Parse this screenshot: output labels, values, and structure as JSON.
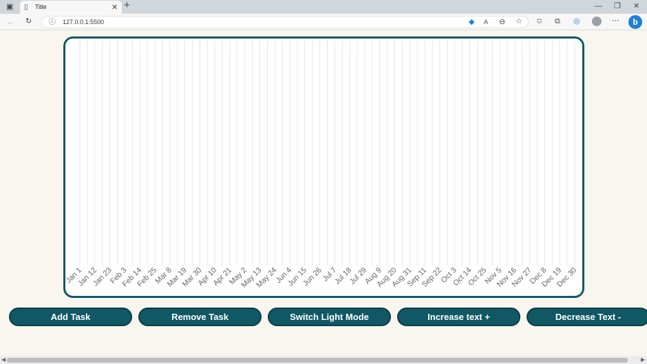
{
  "browser": {
    "tab_title": "Title",
    "url": "127.0.0.1:5500",
    "new_tab_symbol": "+"
  },
  "chart_data": {
    "type": "bar",
    "categories": [
      "Jan 1",
      "Jan 12",
      "Jan 23",
      "Feb 3",
      "Feb 14",
      "Feb 25",
      "Mar 8",
      "Mar 19",
      "Mar 30",
      "Apr 10",
      "Apr 21",
      "May 2",
      "May 13",
      "May 24",
      "Jun 4",
      "Jun 15",
      "Jun 26",
      "Jul 7",
      "Jul 18",
      "Jul 29",
      "Aug 9",
      "Aug 20",
      "Aug 31",
      "Sep 11",
      "Sep 22",
      "Oct 3",
      "Oct 14",
      "Oct 25",
      "Nov 5",
      "Nov 16",
      "Nov 27",
      "Dec 8",
      "Dec 19",
      "Dec 30"
    ],
    "values": [],
    "grid": true,
    "grid_color": "#e6e6e6",
    "border_color": "#115865"
  },
  "buttons": {
    "add": "Add Task",
    "remove": "Remove Task",
    "switch_mode": "Switch Light Mode",
    "increase": "Increase text +",
    "decrease": "Decrease Text -"
  },
  "colors": {
    "button_bg": "#115865",
    "page_bg": "#f9f6f0"
  }
}
